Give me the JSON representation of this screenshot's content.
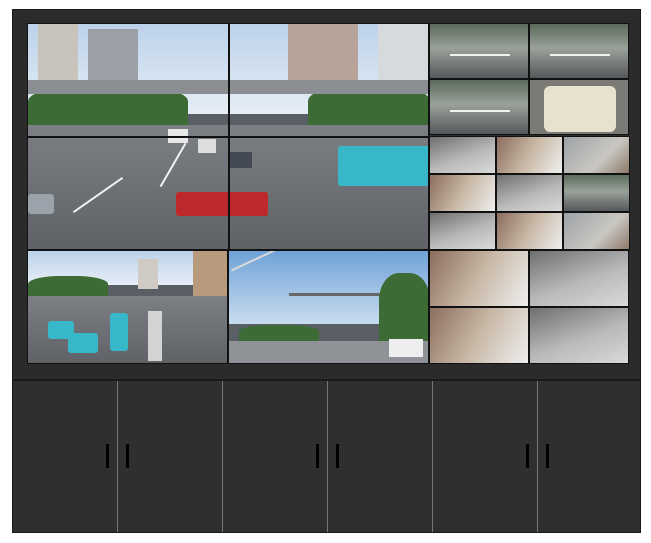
{
  "video_wall": {
    "large_screens": [
      {
        "id": "cam-1",
        "scene": "intersection-overpass"
      },
      {
        "id": "cam-2",
        "scene": "intersection-bus"
      },
      {
        "id": "cam-3",
        "scene": "brt-corridor"
      },
      {
        "id": "cam-4",
        "scene": "street-gantry"
      }
    ],
    "small_feeds_top_right": [
      "traffic-1",
      "traffic-2",
      "traffic-3",
      "traffic-4"
    ],
    "small_feeds_mid_right": [
      "yard-1",
      "yard-2",
      "yard-3",
      "yard-4",
      "yard-5",
      "yard-6",
      "yard-7",
      "yard-8",
      "yard-9"
    ],
    "small_feeds_bottom_right": [
      "plaza-1",
      "plaza-2",
      "plaza-3",
      "plaza-4"
    ]
  },
  "cabinet": {
    "doors": [
      "door-1",
      "door-2",
      "door-3",
      "door-4",
      "door-5",
      "door-6"
    ]
  },
  "colors": {
    "frame": "#2b2b2b",
    "cabinet": "#2f2f2f",
    "bus": "#38b7c8",
    "car": "#c0292b"
  }
}
